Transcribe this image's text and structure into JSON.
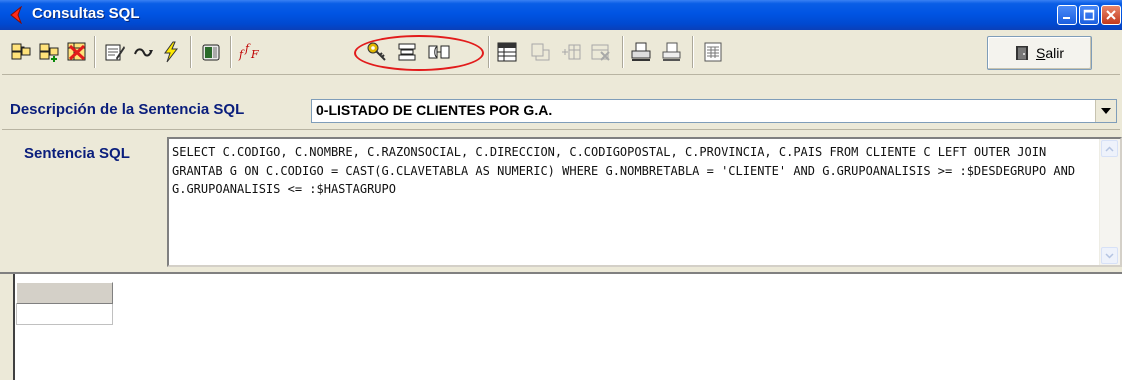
{
  "window": {
    "title": "Consultas SQL"
  },
  "toolbar": {
    "buttons": [
      {
        "icon": "open-query-icon"
      },
      {
        "icon": "add-query-icon"
      },
      {
        "icon": "delete-query-icon"
      },
      {
        "icon": "edit-query-icon"
      },
      {
        "icon": "undo-icon"
      },
      {
        "icon": "execute-lightning-icon"
      },
      {
        "icon": "database-icon"
      },
      {
        "icon": "functions-icon"
      },
      {
        "icon": "keys-icon"
      },
      {
        "icon": "table-icon"
      },
      {
        "icon": "join-tables-icon"
      },
      {
        "icon": "grid-icon"
      },
      {
        "icon": "disabled-copy-icon"
      },
      {
        "icon": "disabled-paste-icon"
      },
      {
        "icon": "disabled-export-icon"
      },
      {
        "icon": "print-icon"
      },
      {
        "icon": "print-preview-icon"
      },
      {
        "icon": "report-icon"
      }
    ],
    "salir_label_first": "S",
    "salir_label_rest": "alir",
    "accent_color": "#e21b1b"
  },
  "description": {
    "label": "Descripción de la Sentencia SQL",
    "value": "0-LISTADO DE CLIENTES POR G.A."
  },
  "sql": {
    "label": "Sentencia SQL",
    "text": "SELECT C.CODIGO, C.NOMBRE, C.RAZONSOCIAL, C.DIRECCION, C.CODIGOPOSTAL, C.PROVINCIA, C.PAIS FROM CLIENTE C LEFT OUTER JOIN GRANTAB G ON C.CODIGO = CAST(G.CLAVETABLA AS NUMERIC) WHERE G.NOMBRETABLA = 'CLIENTE' AND G.GRUPOANALISIS >= :$DESDEGRUPO AND G.GRUPOANALISIS <= :$HASTAGRUPO"
  },
  "colors": {
    "title_bar": "#0054e3",
    "label_text": "#0a1e7c",
    "window_face": "#ece9d8"
  }
}
